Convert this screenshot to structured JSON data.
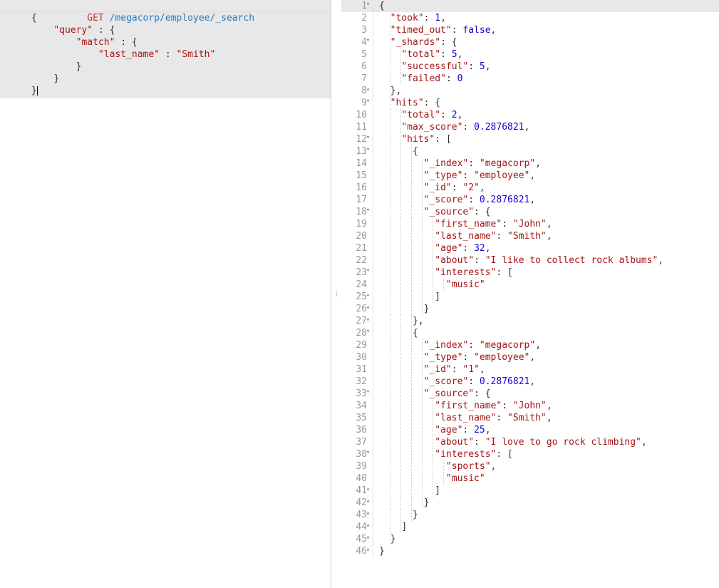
{
  "request": {
    "method": "GET",
    "url": "/megacorp/employee/_search",
    "bodyLines": [
      "{",
      "    \"query\" : {",
      "        \"match\" : {",
      "            \"last_name\" : \"Smith\"",
      "        }",
      "    }",
      "}"
    ]
  },
  "response": {
    "lines": [
      {
        "n": 1,
        "fold": "open",
        "t": "{"
      },
      {
        "n": 2,
        "t": "  \"took\": 1,"
      },
      {
        "n": 3,
        "t": "  \"timed_out\": false,"
      },
      {
        "n": 4,
        "fold": "open",
        "t": "  \"_shards\": {"
      },
      {
        "n": 5,
        "t": "    \"total\": 5,"
      },
      {
        "n": 6,
        "t": "    \"successful\": 5,"
      },
      {
        "n": 7,
        "t": "    \"failed\": 0"
      },
      {
        "n": 8,
        "fold": "close",
        "t": "  },"
      },
      {
        "n": 9,
        "fold": "open",
        "t": "  \"hits\": {"
      },
      {
        "n": 10,
        "t": "    \"total\": 2,"
      },
      {
        "n": 11,
        "t": "    \"max_score\": 0.2876821,"
      },
      {
        "n": 12,
        "fold": "open",
        "t": "    \"hits\": ["
      },
      {
        "n": 13,
        "fold": "open",
        "t": "      {"
      },
      {
        "n": 14,
        "t": "        \"_index\": \"megacorp\","
      },
      {
        "n": 15,
        "t": "        \"_type\": \"employee\","
      },
      {
        "n": 16,
        "t": "        \"_id\": \"2\","
      },
      {
        "n": 17,
        "t": "        \"_score\": 0.2876821,"
      },
      {
        "n": 18,
        "fold": "open",
        "t": "        \"_source\": {"
      },
      {
        "n": 19,
        "t": "          \"first_name\": \"John\","
      },
      {
        "n": 20,
        "t": "          \"last_name\": \"Smith\","
      },
      {
        "n": 21,
        "t": "          \"age\": 32,"
      },
      {
        "n": 22,
        "t": "          \"about\": \"I like to collect rock albums\","
      },
      {
        "n": 23,
        "fold": "open",
        "t": "          \"interests\": ["
      },
      {
        "n": 24,
        "t": "            \"music\""
      },
      {
        "n": 25,
        "fold": "close",
        "t": "          ]"
      },
      {
        "n": 26,
        "fold": "close",
        "t": "        }"
      },
      {
        "n": 27,
        "fold": "close",
        "t": "      },"
      },
      {
        "n": 28,
        "fold": "open",
        "t": "      {"
      },
      {
        "n": 29,
        "t": "        \"_index\": \"megacorp\","
      },
      {
        "n": 30,
        "t": "        \"_type\": \"employee\","
      },
      {
        "n": 31,
        "t": "        \"_id\": \"1\","
      },
      {
        "n": 32,
        "t": "        \"_score\": 0.2876821,"
      },
      {
        "n": 33,
        "fold": "open",
        "t": "        \"_source\": {"
      },
      {
        "n": 34,
        "t": "          \"first_name\": \"John\","
      },
      {
        "n": 35,
        "t": "          \"last_name\": \"Smith\","
      },
      {
        "n": 36,
        "t": "          \"age\": 25,"
      },
      {
        "n": 37,
        "t": "          \"about\": \"I love to go rock climbing\","
      },
      {
        "n": 38,
        "fold": "open",
        "t": "          \"interests\": ["
      },
      {
        "n": 39,
        "t": "            \"sports\","
      },
      {
        "n": 40,
        "t": "            \"music\""
      },
      {
        "n": 41,
        "fold": "close",
        "t": "          ]"
      },
      {
        "n": 42,
        "fold": "close",
        "t": "        }"
      },
      {
        "n": 43,
        "fold": "close",
        "t": "      }"
      },
      {
        "n": 44,
        "fold": "close",
        "t": "    ]"
      },
      {
        "n": 45,
        "fold": "close",
        "t": "  }"
      },
      {
        "n": 46,
        "fold": "close",
        "t": "}"
      }
    ]
  },
  "icons": {
    "run": "run-icon",
    "wrench": "settings-icon"
  }
}
